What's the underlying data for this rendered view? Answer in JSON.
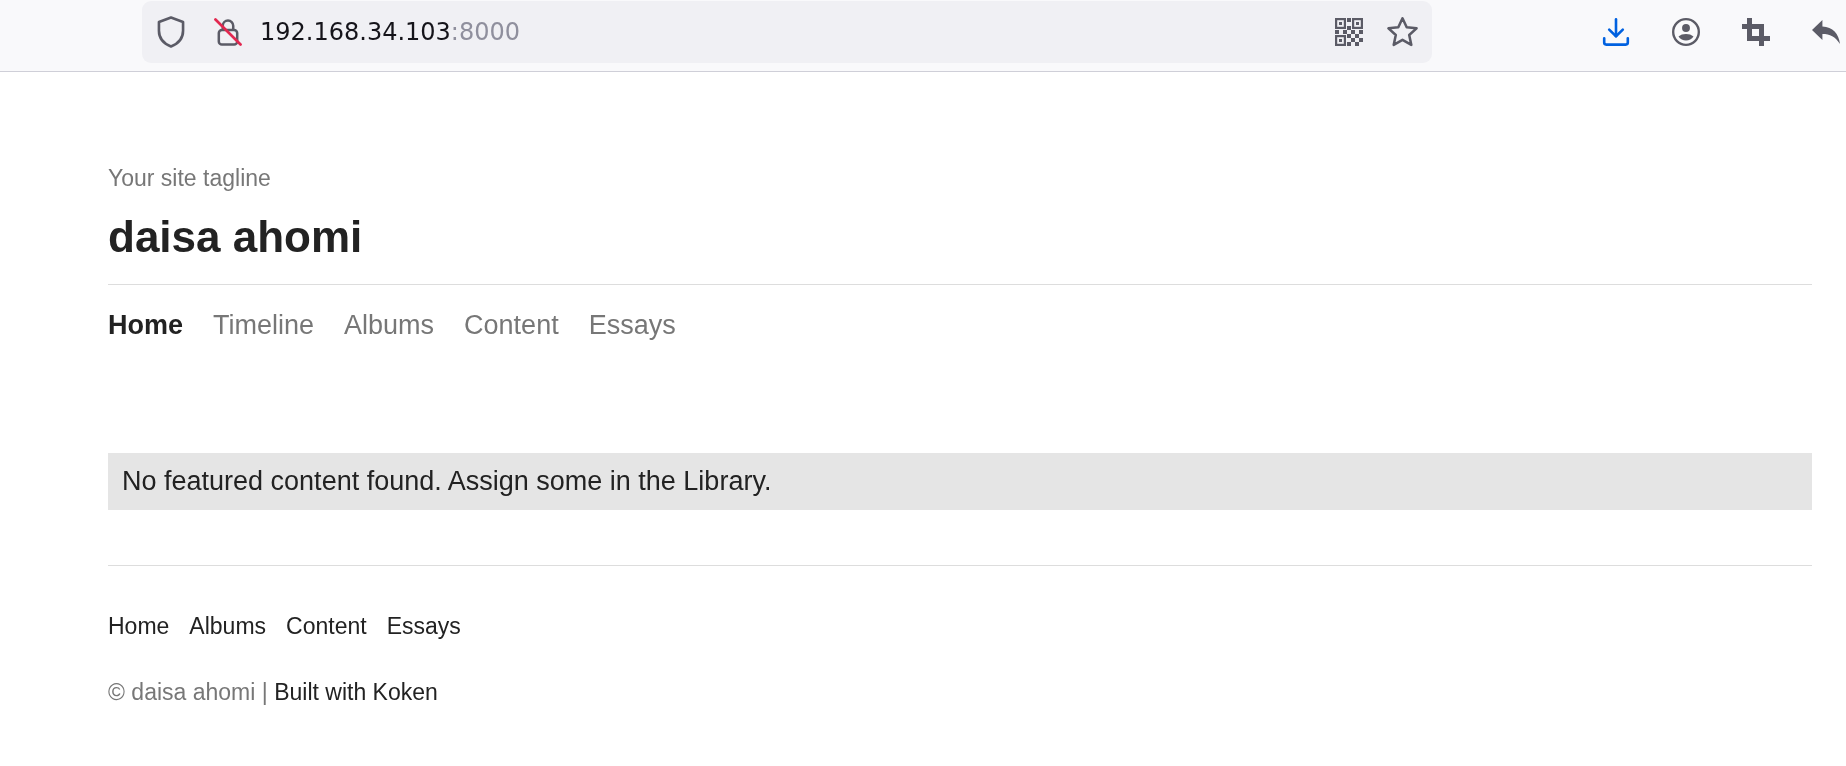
{
  "browser": {
    "url": {
      "host": "192.168.34.103",
      "port": ":8000"
    }
  },
  "site": {
    "tagline": "Your site tagline",
    "title": "daisa ahomi"
  },
  "nav": [
    {
      "label": "Home",
      "selected": true
    },
    {
      "label": "Timeline",
      "selected": false
    },
    {
      "label": "Albums",
      "selected": false
    },
    {
      "label": "Content",
      "selected": false
    },
    {
      "label": "Essays",
      "selected": false
    }
  ],
  "notice": "No featured content found. Assign some in the Library.",
  "footer_nav": [
    "Home",
    "Albums",
    "Content",
    "Essays"
  ],
  "footer": {
    "copyright": "© daisa ahomi |",
    "credit_link": "Built with Koken"
  }
}
